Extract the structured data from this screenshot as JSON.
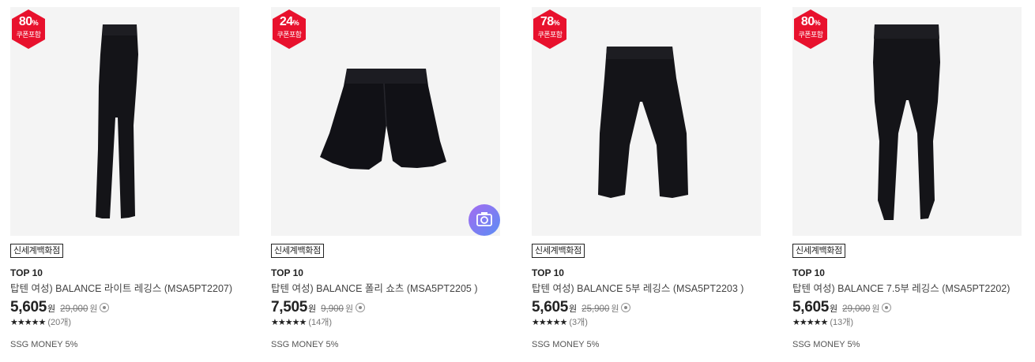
{
  "colors": {
    "badge_red": "#e8112d",
    "photo_badge_gradient": [
      "#a46bf0",
      "#5b8df4"
    ]
  },
  "products": [
    {
      "discount_pct": "80",
      "pct_sign": "%",
      "coupon_label": "쿠폰포함",
      "image": "black-leggings",
      "photo_review": false,
      "store": "신세계백화점",
      "rank": "TOP 10",
      "title": "탑텐 여성) BALANCE 라이트 레깅스 (MSA5PT2207)",
      "price": "5,605",
      "won": "원",
      "original_price": "29,000",
      "won2": "원",
      "stars": "★★★★★",
      "rating_score": 5,
      "review_count": "(20개)",
      "money": "SSG MONEY 5%"
    },
    {
      "discount_pct": "24",
      "pct_sign": "%",
      "coupon_label": "쿠폰포함",
      "image": "black-shorts",
      "photo_review": true,
      "photo_review_icon": "camera-icon",
      "store": "신세계백화점",
      "rank": "TOP 10",
      "title": "탑텐 여성) BALANCE 폴리 쇼츠 (MSA5PT2205 )",
      "price": "7,505",
      "won": "원",
      "original_price": "9,900",
      "won2": "원",
      "stars": "★★★★★",
      "rating_score": 4.5,
      "review_count": "(14개)",
      "money": "SSG MONEY 5%"
    },
    {
      "discount_pct": "78",
      "pct_sign": "%",
      "coupon_label": "쿠폰포함",
      "image": "black-bike-shorts",
      "photo_review": false,
      "store": "신세계백화점",
      "rank": "TOP 10",
      "title": "탑텐 여성) BALANCE 5부 레깅스 (MSA5PT2203 )",
      "price": "5,605",
      "won": "원",
      "original_price": "25,900",
      "won2": "원",
      "stars": "★★★★★",
      "rating_score": 5,
      "review_count": "(3개)",
      "money": "SSG MONEY 5%"
    },
    {
      "discount_pct": "80",
      "pct_sign": "%",
      "coupon_label": "쿠폰포함",
      "image": "black-cropped-leggings",
      "photo_review": false,
      "store": "신세계백화점",
      "rank": "TOP 10",
      "title": "탑텐 여성) BALANCE 7.5부 레깅스 (MSA5PT2202)",
      "price": "5,605",
      "won": "원",
      "original_price": "29,000",
      "won2": "원",
      "stars": "★★★★★",
      "rating_score": 5,
      "review_count": "(13개)",
      "money": "SSG MONEY 5%"
    }
  ]
}
